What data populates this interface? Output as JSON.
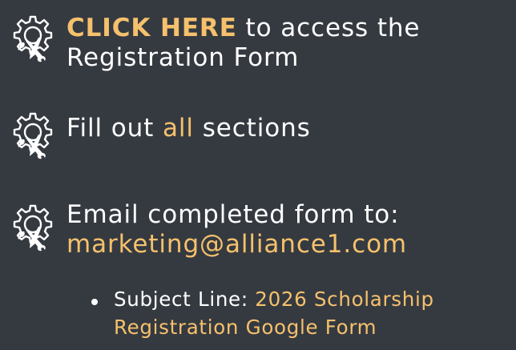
{
  "steps": [
    {
      "icon": "gear-wrench-pencil-icon",
      "link": "CLICK HERE",
      "line1_rest": " to access the",
      "line2": "Registration Form"
    },
    {
      "icon": "gear-wrench-pencil-icon",
      "prefix": "Fill out ",
      "highlight": "all",
      "suffix": " sections"
    },
    {
      "icon": "gear-wrench-pencil-icon",
      "line1": "Email completed form to:",
      "email": "marketing@alliance1.com"
    }
  ],
  "bullet": {
    "label": "Subject Line: ",
    "value_line1": "2026 Scholarship",
    "value_line2": "Registration Google Form"
  },
  "colors": {
    "background": "#353a41",
    "text": "#ffffff",
    "accent": "#f6c16c"
  }
}
